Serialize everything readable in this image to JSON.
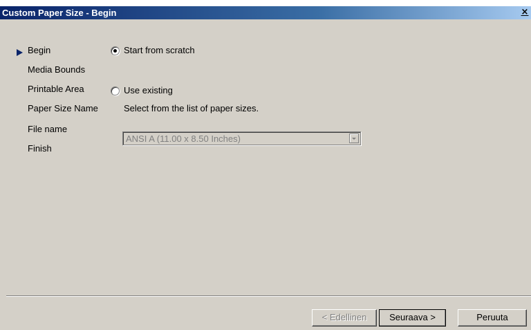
{
  "window": {
    "title": "Custom Paper Size - Begin",
    "close_glyph": "×"
  },
  "steps": [
    {
      "label": "Begin",
      "current": true
    },
    {
      "label": "Media Bounds",
      "current": false
    },
    {
      "label": "Printable Area",
      "current": false
    },
    {
      "label": "Paper Size Name",
      "current": false
    },
    {
      "label": "File name",
      "current": false
    },
    {
      "label": "Finish",
      "current": false
    }
  ],
  "options": {
    "start_from_scratch": {
      "label": "Start from scratch",
      "selected": true
    },
    "use_existing": {
      "label": "Use existing",
      "selected": false
    },
    "instruction": "Select from the list of paper sizes.",
    "paper_size_select": {
      "value": "ANSI A (11.00 x 8.50 Inches)",
      "enabled": false
    }
  },
  "buttons": {
    "back": "< Edellinen",
    "next": "Seuraava >",
    "cancel": "Peruuta"
  },
  "colors": {
    "dialog_bg": "#d4d0c8",
    "title_bar_start": "#0a246a",
    "title_bar_end": "#a6caf0",
    "arrow": "#0a246a",
    "disabled_text": "#808080"
  }
}
